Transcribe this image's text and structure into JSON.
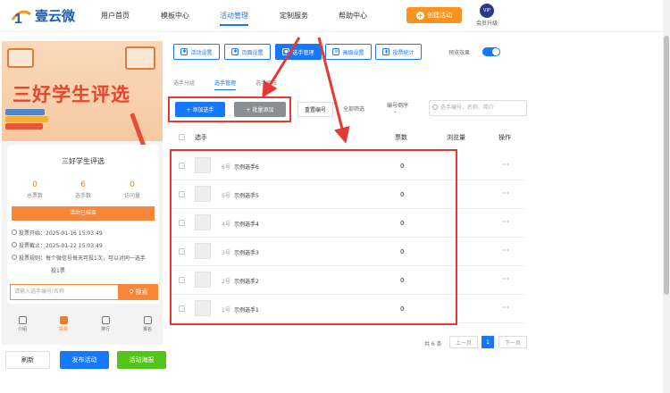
{
  "brand": {
    "name": "壹云微"
  },
  "nav": {
    "items": [
      "用户首页",
      "模板中心",
      "活动管理",
      "定制服务",
      "帮助中心"
    ],
    "create_label": "创建活动",
    "vip_badge": "VIP",
    "vip_label": "会员升级"
  },
  "toolbar": {
    "buttons": [
      "活动设置",
      "页面设置",
      "选手管理",
      "高级设置",
      "投票统计"
    ],
    "active_index": 2,
    "preview_label": "预览效果",
    "preview_on": true
  },
  "subtabs": {
    "items": [
      "选手分组",
      "选手管理",
      "选手审核"
    ],
    "active_index": 1
  },
  "actions": {
    "add_label": "+ 添加选手",
    "batch_label": "+ 批量添加",
    "reset_label": "重置编号",
    "filter_label": "全部筛选",
    "sort_label": "编号倒序",
    "search_placeholder": "选手编号、名称、简介"
  },
  "table": {
    "headers": {
      "player": "选手",
      "votes": "票数",
      "views": "浏览量",
      "ops": "操作"
    },
    "rows": [
      {
        "num": "6号",
        "name": "示例选手6",
        "votes": "0",
        "more": "···"
      },
      {
        "num": "5号",
        "name": "示例选手5",
        "votes": "0",
        "more": "···"
      },
      {
        "num": "4号",
        "name": "示例选手4",
        "votes": "0",
        "more": "···"
      },
      {
        "num": "3号",
        "name": "示例选手3",
        "votes": "0",
        "more": "···"
      },
      {
        "num": "2号",
        "name": "示例选手2",
        "votes": "0",
        "more": "···"
      },
      {
        "num": "1号",
        "name": "示例选手1",
        "votes": "0",
        "more": "···"
      }
    ]
  },
  "pager": {
    "total": "共 6 条",
    "prev": "上一页",
    "current": "1",
    "next": "下一页"
  },
  "preview": {
    "banner_title": "三好学生评选",
    "card_title": "三好学生评选",
    "stats": [
      {
        "value": "0",
        "label": "总票数"
      },
      {
        "value": "6",
        "label": "选手数"
      },
      {
        "value": "0",
        "label": "访问量"
      }
    ],
    "status": "活动已结束",
    "start": "投票开始：2025-01-16 15:03:49",
    "end": "投票截止：2025-01-22 15:03:49",
    "rule_line1": "投票规则：每个微信号每天可投1次，可以对同一选手",
    "rule_line2": "投1票",
    "search_placeholder": "请输入选手编号/名称",
    "search_label": "搜索",
    "tabs": [
      "介绍",
      "投票",
      "排行",
      "报名"
    ],
    "active_tab": 1
  },
  "bottom": {
    "refresh": "刷新",
    "publish": "发布活动",
    "poster": "活动海报"
  },
  "colors": {
    "primary": "#1677ff",
    "orange": "#f7931e",
    "preview_orange": "#f7853a",
    "highlight_red": "#e53935",
    "green": "#52c41a"
  }
}
